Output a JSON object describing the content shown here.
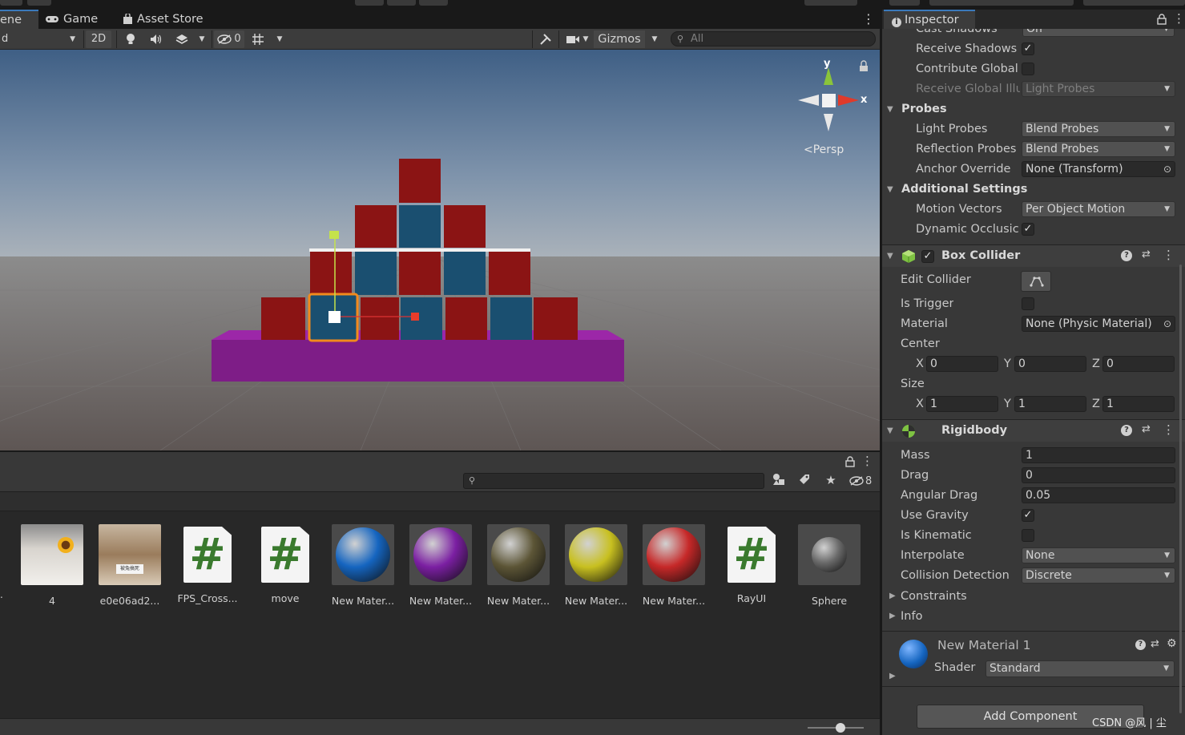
{
  "tabs": {
    "scene": "ene",
    "game": "Game",
    "asset_store": "Asset Store"
  },
  "scene_toolbar": {
    "shading_mode": "d",
    "mode_2d": "2D",
    "hidden_count": "0",
    "gizmos": "Gizmos",
    "search_placeholder": "All"
  },
  "gizmo": {
    "y": "y",
    "x": "x",
    "persp": "Persp"
  },
  "project": {
    "hidden_count": "8",
    "assets": [
      {
        "label": "4",
        "kind": "photo"
      },
      {
        "label": "e0e06ad2...",
        "kind": "photo"
      },
      {
        "label": "FPS_Cross...",
        "kind": "script"
      },
      {
        "label": "move",
        "kind": "script"
      },
      {
        "label": "New Mater...",
        "kind": "material",
        "color": "#1565c0"
      },
      {
        "label": "New Mater...",
        "kind": "material",
        "color": "#7b1fa2"
      },
      {
        "label": "New Mater...",
        "kind": "material",
        "color": "#5c5536"
      },
      {
        "label": "New Mater...",
        "kind": "material",
        "color": "#c8c020"
      },
      {
        "label": "New Mater...",
        "kind": "material",
        "color": "#c62828"
      },
      {
        "label": "RayUI",
        "kind": "script"
      },
      {
        "label": "Sphere",
        "kind": "mesh",
        "color": "#6a6a6a"
      }
    ],
    "script_glyph": "#",
    "photo_caption": "被兔搞死"
  },
  "inspector": {
    "title": "Inspector",
    "cast_shadows": {
      "label": "Cast Shadows",
      "value": "On"
    },
    "receive_shadows": {
      "label": "Receive Shadows",
      "checked": true
    },
    "contribute_gi": {
      "label": "Contribute Global",
      "checked": false
    },
    "receive_gi": {
      "label": "Receive Global Illu",
      "value": "Light Probes"
    },
    "probes": {
      "title": "Probes",
      "light_probes": {
        "label": "Light Probes",
        "value": "Blend Probes"
      },
      "reflection_probes": {
        "label": "Reflection Probes",
        "value": "Blend Probes"
      },
      "anchor_override": {
        "label": "Anchor Override",
        "value": "None (Transform)"
      }
    },
    "additional": {
      "title": "Additional Settings",
      "motion_vectors": {
        "label": "Motion Vectors",
        "value": "Per Object Motion"
      },
      "dynamic_occlusion": {
        "label": "Dynamic Occlusic",
        "checked": true
      }
    },
    "box_collider": {
      "title": "Box Collider",
      "edit_collider": "Edit Collider",
      "is_trigger": "Is Trigger",
      "material": {
        "label": "Material",
        "value": "None (Physic Material)"
      },
      "center": {
        "label": "Center",
        "x": "0",
        "y": "0",
        "z": "0"
      },
      "size": {
        "label": "Size",
        "x": "1",
        "y": "1",
        "z": "1"
      }
    },
    "rigidbody": {
      "title": "Rigidbody",
      "mass": {
        "label": "Mass",
        "value": "1"
      },
      "drag": {
        "label": "Drag",
        "value": "0"
      },
      "angular_drag": {
        "label": "Angular Drag",
        "value": "0.05"
      },
      "use_gravity": {
        "label": "Use Gravity",
        "checked": true
      },
      "is_kinematic": {
        "label": "Is Kinematic",
        "checked": false
      },
      "interpolate": {
        "label": "Interpolate",
        "value": "None"
      },
      "collision_detection": {
        "label": "Collision Detection",
        "value": "Discrete"
      },
      "constraints": "Constraints",
      "info": "Info"
    },
    "material": {
      "name": "New Material 1",
      "shader_label": "Shader",
      "shader_value": "Standard"
    },
    "add_component": "Add Component",
    "axis_x": "X",
    "axis_y": "Y",
    "axis_z": "Z"
  },
  "watermark": "CSDN @风 | 尘",
  "colors": {
    "red_cube": "#8b1414",
    "blue_cube": "#1a4f70",
    "base": "#7e1d87",
    "accent": "#3a79bb",
    "selection": "#f28a1c"
  }
}
